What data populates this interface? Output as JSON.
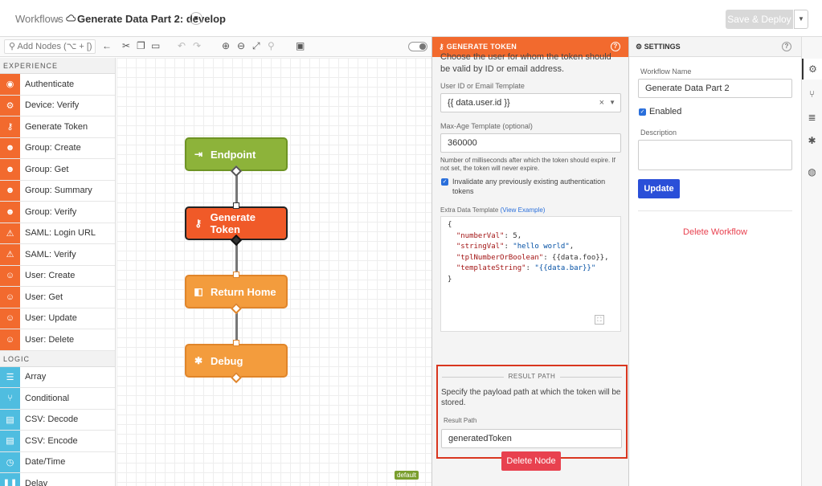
{
  "header": {
    "breadcrumb_root": "Workflows",
    "breadcrumb_sep": "›",
    "workflow_title": "Generate Data Part 2: develop",
    "save_deploy": "Save & Deploy"
  },
  "toolbar": {
    "search_placeholder": "Add Nodes (⌥ + [)"
  },
  "palette": {
    "experience_label": "EXPERIENCE",
    "logic_label": "LOGIC",
    "experience_items": [
      {
        "label": "Authenticate",
        "icon": "fingerprint-icon",
        "glyph": "◉"
      },
      {
        "label": "Device: Verify",
        "icon": "device-verify-icon",
        "glyph": "⚙"
      },
      {
        "label": "Generate Token",
        "icon": "key-icon",
        "glyph": "⚷"
      },
      {
        "label": "Group: Create",
        "icon": "group-create-icon",
        "glyph": "☻"
      },
      {
        "label": "Group: Get",
        "icon": "group-get-icon",
        "glyph": "☻"
      },
      {
        "label": "Group: Summary",
        "icon": "group-summary-icon",
        "glyph": "☻"
      },
      {
        "label": "Group: Verify",
        "icon": "group-verify-icon",
        "glyph": "☻"
      },
      {
        "label": "SAML: Login URL",
        "icon": "saml-login-icon",
        "glyph": "⚠"
      },
      {
        "label": "SAML: Verify",
        "icon": "saml-verify-icon",
        "glyph": "⚠"
      },
      {
        "label": "User: Create",
        "icon": "user-create-icon",
        "glyph": "☺"
      },
      {
        "label": "User: Get",
        "icon": "user-get-icon",
        "glyph": "☺"
      },
      {
        "label": "User: Update",
        "icon": "user-update-icon",
        "glyph": "☺"
      },
      {
        "label": "User: Delete",
        "icon": "user-delete-icon",
        "glyph": "☺"
      }
    ],
    "logic_items": [
      {
        "label": "Array",
        "icon": "list-icon",
        "glyph": "☰"
      },
      {
        "label": "Conditional",
        "icon": "branch-icon",
        "glyph": "⑂"
      },
      {
        "label": "CSV: Decode",
        "icon": "document-icon",
        "glyph": "▤"
      },
      {
        "label": "CSV: Encode",
        "icon": "document-icon",
        "glyph": "▤"
      },
      {
        "label": "Date/Time",
        "icon": "clock-icon",
        "glyph": "◷"
      },
      {
        "label": "Delay",
        "icon": "pause-icon",
        "glyph": "❚❚"
      }
    ]
  },
  "canvas": {
    "nodes": [
      {
        "label": "Endpoint",
        "icon": "endpoint-icon",
        "glyph": "⇥",
        "color": "#8db33a",
        "border": "#6e9424"
      },
      {
        "label": "Generate Token",
        "icon": "key-icon",
        "glyph": "⚷",
        "color": "#f05a28",
        "border": "#222222"
      },
      {
        "label": "Return Home",
        "icon": "return-icon",
        "glyph": "◧",
        "color": "#f39c3d",
        "border": "#e0852a"
      },
      {
        "label": "Debug",
        "icon": "bug-icon",
        "glyph": "✱",
        "color": "#f39c3d",
        "border": "#e0852a"
      }
    ],
    "version_tag": "default"
  },
  "node_panel": {
    "title": "GENERATE TOKEN",
    "intro_text": "Choose the user for whom the token should be valid by ID or email address.",
    "user_label": "User ID or Email Template",
    "user_value": "{{ data.user.id }}",
    "maxage_label": "Max-Age Template (optional)",
    "maxage_value": "360000",
    "maxage_help": "Number of milliseconds after which the token should expire. If not set, the token will never expire.",
    "invalidate_label": "Invalidate any previously existing authentication tokens",
    "extra_label": "Extra Data Template",
    "extra_link": "(View Example)",
    "code": {
      "open": "{",
      "l1k": "\"numberVal\"",
      "l1v": ": 5,",
      "l2k": "\"stringVal\"",
      "l2s": "\"hello world\"",
      "l2e": ",",
      "l3k": "\"tplNumberOrBoolean\"",
      "l3v": ": {{data.foo}},",
      "l4k": "\"templateString\"",
      "l4s": "\"{{data.bar}}\"",
      "close": "}"
    },
    "result_path_title": "RESULT PATH",
    "result_path_desc": "Specify the payload path at which the token will be stored.",
    "result_path_label": "Result Path",
    "result_path_value": "generatedToken",
    "delete_node": "Delete Node"
  },
  "settings": {
    "title": "SETTINGS",
    "name_label": "Workflow Name",
    "name_value": "Generate Data Part 2",
    "enabled_label": "Enabled",
    "description_label": "Description",
    "update_label": "Update",
    "delete_workflow": "Delete Workflow"
  }
}
